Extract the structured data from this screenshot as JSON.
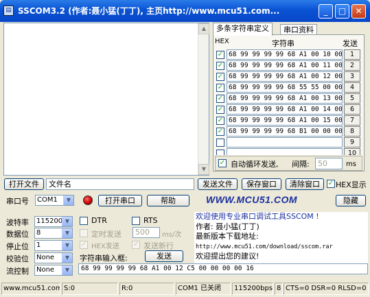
{
  "window": {
    "title": "SSCOM3.2 (作者:聂小猛(丁丁), 主页http://www.mcu51.com..."
  },
  "tabs": [
    {
      "label": "多条字符串定义"
    },
    {
      "label": "串口资料"
    }
  ],
  "multi": {
    "col_hex": "HEX",
    "col_string": "字符串",
    "col_send": "发送",
    "rows": [
      {
        "checked": "✓",
        "value": "68 99 99 99 99 68 A1 00 10 00",
        "send": "1"
      },
      {
        "checked": "✓",
        "value": "68 99 99 99 99 68 A1 00 11 00",
        "send": "2"
      },
      {
        "checked": "✓",
        "value": "68 99 99 99 99 68 A1 00 12 00",
        "send": "3"
      },
      {
        "checked": "✓",
        "value": "68 99 99 99 99 68 55 55 00 00",
        "send": "4"
      },
      {
        "checked": "✓",
        "value": "68 99 99 99 99 68 A1 00 13 00",
        "send": "5"
      },
      {
        "checked": "✓",
        "value": "68 99 99 99 99 68 A1 00 14 00",
        "send": "6"
      },
      {
        "checked": "✓",
        "value": "68 99 99 99 99 68 A1 00 15 00",
        "send": "7"
      },
      {
        "checked": "✓",
        "value": "68 99 99 99 99 68 B1 00 00 00",
        "send": "8"
      },
      {
        "checked": "",
        "value": "",
        "send": "9"
      },
      {
        "checked": "",
        "value": "",
        "send": "10"
      }
    ],
    "loop_checked": "✓",
    "loop_label": "自动循环发送,",
    "interval_label": "间隔:",
    "interval_value": "50",
    "interval_unit": "ms"
  },
  "toolbar": {
    "open_file": "打开文件",
    "file_name": "文件名",
    "send_file": "发送文件",
    "save_window": "保存窗口",
    "clear_window": "清除窗口",
    "hex_display_checked": "✓",
    "hex_display": "HEX显示"
  },
  "port": {
    "label": "串口号",
    "value": "COM1",
    "open_button": "打开串口",
    "help_button": "帮助",
    "brand": "WWW.MCU51.COM",
    "hide_button": "隐藏"
  },
  "settings": {
    "baud_label": "波特率",
    "baud_value": "115200",
    "data_label": "数据位",
    "data_value": "8",
    "stop_label": "停止位",
    "stop_value": "1",
    "parity_label": "校验位",
    "parity_value": "None",
    "flow_label": "流控制",
    "flow_value": "None"
  },
  "send": {
    "dtr": "DTR",
    "rts": "RTS",
    "timed_label": "定时发送",
    "timed_value": "500",
    "timed_unit": "ms/次",
    "hex_send": "HEX发送",
    "send_newline": "发送新行",
    "input_label": "字符串输入框:",
    "send_button": "发送",
    "input_value": "68 99 99 99 99 68 A1 00 12 C5 00 00 00 00 16"
  },
  "info": {
    "line1": "欢迎使用专业串口调试工具SSCOM !",
    "line2": "作者: 聂小猛(丁丁)",
    "line3": "最新版本下载地址:",
    "line4": "http://www.mcu51.com/download/sscom.rar",
    "line5": "欢迎提出您的建议!"
  },
  "status": {
    "site": "www.mcu51.com",
    "sent": "S:0",
    "recv": "R:0",
    "port_state": "COM1 已关闭",
    "baud": "115200bps",
    "data_bits": "8",
    "lines": "CTS=0 DSR=0 RLSD=0"
  },
  "colors": {
    "title_bar": "#0a53d4",
    "brand": "#1a2f9e",
    "led": "#cc0000",
    "check": "#21a121"
  }
}
